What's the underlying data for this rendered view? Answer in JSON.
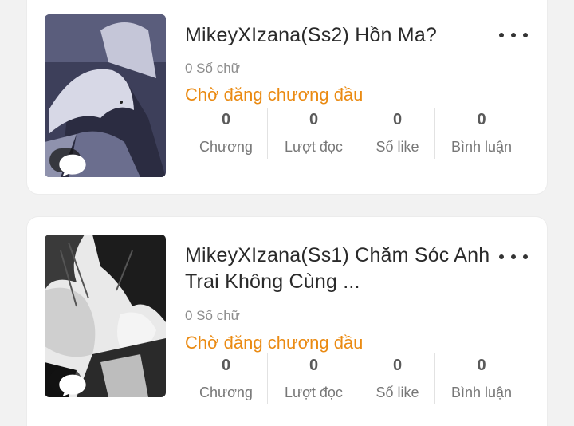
{
  "stories": [
    {
      "title": "MikeyXIzana(Ss2) Hồn Ma?",
      "word_count": "0 Số chữ",
      "status": "Chờ đăng chương đầu",
      "stats": [
        {
          "value": "0",
          "label": "Chương"
        },
        {
          "value": "0",
          "label": "Lượt đọc"
        },
        {
          "value": "0",
          "label": "Số like"
        },
        {
          "value": "0",
          "label": "Bình luận"
        }
      ]
    },
    {
      "title": "MikeyXIzana(Ss1) Chăm Sóc Anh Trai Không Cùng ...",
      "word_count": "0 Số chữ",
      "status": "Chờ đăng chương đầu",
      "stats": [
        {
          "value": "0",
          "label": "Chương"
        },
        {
          "value": "0",
          "label": "Lượt đọc"
        },
        {
          "value": "0",
          "label": "Số like"
        },
        {
          "value": "0",
          "label": "Bình luận"
        }
      ]
    }
  ],
  "colors": {
    "status": "#ea8a12",
    "title": "#2a2a2a",
    "background": "#f2f2f2"
  },
  "icons": {
    "more": "more-options-icon",
    "chat": "chat-bubble-icon"
  }
}
